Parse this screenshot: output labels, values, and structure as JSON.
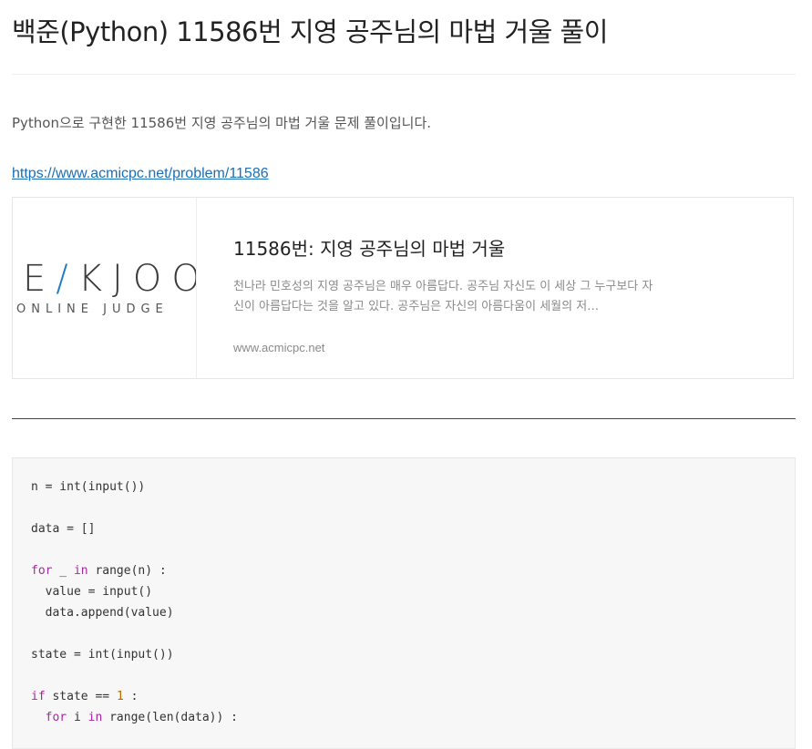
{
  "page": {
    "title": "백준(Python) 11586번 지영 공주님의 마법 거울 풀이",
    "intro": "Python으로 구현한 11586번 지영 공주님의 마법 거울 문제 풀이입니다.",
    "link_text": "https://www.acmicpc.net/problem/11586"
  },
  "card": {
    "logo_main_left": "E",
    "logo_main_slash": "/",
    "logo_main_right": "KJOO",
    "logo_sub": "ONLINE JUDGE",
    "title": "11586번: 지영 공주님의 마법 거울",
    "description": "천나라 민호성의 지영 공주님은 매우 아름답다. 공주님 자신도 이 세상 그 누구보다 자신이 아름답다는 것을 알고 있다. 공주님은 자신의 아름다움이 세월의 저…",
    "domain": "www.acmicpc.net"
  },
  "code": {
    "lines": [
      [
        {
          "t": "n = int(input())"
        }
      ],
      [
        {
          "t": ""
        }
      ],
      [
        {
          "t": "data = []"
        }
      ],
      [
        {
          "t": ""
        }
      ],
      [
        {
          "t": "for",
          "c": "kw"
        },
        {
          "t": " _ "
        },
        {
          "t": "in",
          "c": "kw"
        },
        {
          "t": " range(n) :"
        }
      ],
      [
        {
          "t": "  value = input()"
        }
      ],
      [
        {
          "t": "  data.append(value)"
        }
      ],
      [
        {
          "t": ""
        }
      ],
      [
        {
          "t": "state = int(input())"
        }
      ],
      [
        {
          "t": ""
        }
      ],
      [
        {
          "t": "if",
          "c": "kw"
        },
        {
          "t": " state == "
        },
        {
          "t": "1",
          "c": "num"
        },
        {
          "t": " :"
        }
      ],
      [
        {
          "t": "  "
        },
        {
          "t": "for",
          "c": "kw"
        },
        {
          "t": " i "
        },
        {
          "t": "in",
          "c": "kw"
        },
        {
          "t": " range(len(data)) :"
        }
      ]
    ]
  },
  "colors": {
    "link": "#1a6fb9",
    "keyword": "#a626a4",
    "number": "#b76b01",
    "code_bg": "#f7f7f7",
    "logo_accent": "#1e7dc8"
  }
}
